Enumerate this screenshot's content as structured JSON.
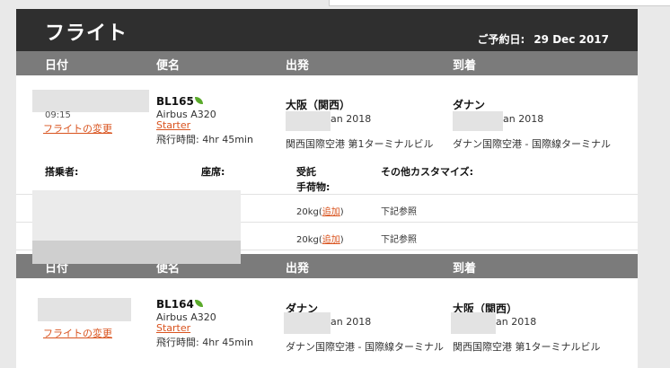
{
  "page": {
    "title": "フライト",
    "booking_label": "ご予約日:",
    "booking_date": "29 Dec 2017"
  },
  "columns": {
    "date": "日付",
    "flight": "便名",
    "departure": "出発",
    "arrival": "到着"
  },
  "outbound": {
    "time": "09:15",
    "change_link": "フライトの変更",
    "flight_no": "BL165",
    "aircraft": "Airbus A320",
    "fare": "Starter",
    "duration_label": "飛行時間:",
    "duration": "4hr 45min",
    "dep_city": "大阪（関西）",
    "dep_date": "an 2018",
    "dep_airport": "関西国際空港 第1ターミナルビル",
    "arr_city": "ダナン",
    "arr_date": "an 2018",
    "arr_airport": "ダナン国際空港 - 国際線ターミナル"
  },
  "passenger_header": {
    "passenger": "搭乗者:",
    "seat": "座席:",
    "baggage": "受託\n手荷物:",
    "other": "その他カスタマイズ:"
  },
  "passengers": [
    {
      "baggage": "20kg",
      "add": "追加",
      "close": ")",
      "other": "下記参照"
    },
    {
      "baggage": "20kg",
      "add": "追加",
      "close": ")",
      "other": "下記参照"
    }
  ],
  "inbound": {
    "change_link": "フライトの変更",
    "flight_no": "BL164",
    "aircraft": "Airbus A320",
    "fare": "Starter",
    "duration_label": "飛行時間:",
    "duration": "4hr 45min",
    "dep_city": "ダナン",
    "dep_date": "an 2018",
    "dep_airport": "ダナン国際空港 - 国際線ターミナル",
    "arr_city": "大阪（関西）",
    "arr_date": "an 2018",
    "arr_airport": "関西国際空港 第1ターミナルビル"
  },
  "colors": {
    "header_bg": "#2f2f2f",
    "column_bar_bg": "#7b7b7b",
    "link": "#d9531e",
    "leaf": "#5aaa2a"
  }
}
